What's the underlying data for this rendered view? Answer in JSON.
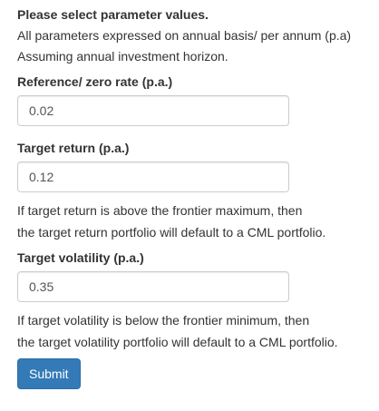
{
  "intro": {
    "title": "Please select parameter values.",
    "line1": "All parameters expressed on annual basis/ per annum (p.a)",
    "line2": "Assuming annual investment horizon."
  },
  "fields": {
    "reference_rate": {
      "label": "Reference/ zero rate (p.a.)",
      "value": "0.02"
    },
    "target_return": {
      "label": "Target return (p.a.)",
      "value": "0.12",
      "help_line1": "If target return is above the frontier maximum, then",
      "help_line2": "the target return portfolio will default to a CML portfolio."
    },
    "target_volatility": {
      "label": "Target volatility (p.a.)",
      "value": "0.35",
      "help_line1": "If target volatility is below the frontier minimum, then",
      "help_line2": "the target volatility portfolio will default to a CML portfolio."
    }
  },
  "actions": {
    "submit_label": "Submit"
  },
  "colors": {
    "primary_button": "#337ab7",
    "input_border": "#cccccc",
    "text": "#333333"
  }
}
